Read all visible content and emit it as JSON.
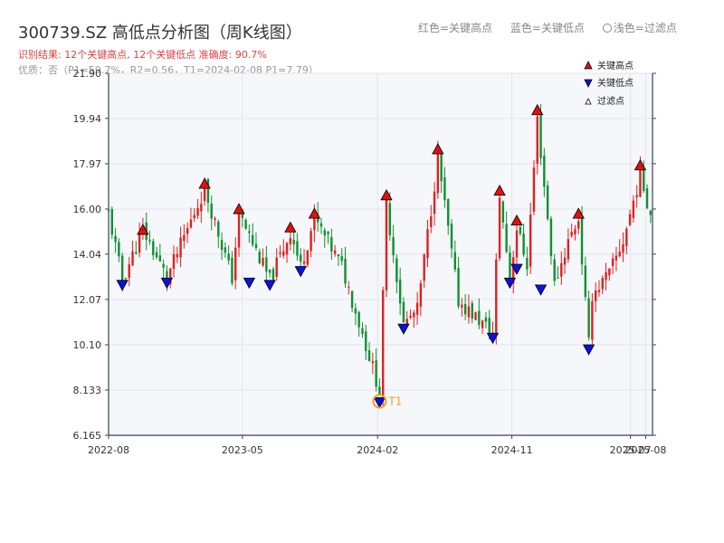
{
  "header": {
    "title": "300739.SZ 高低点分析图（周K线图）",
    "result": "识别结果: 12个关键高点, 12个关键低点   准确度: 90.7%",
    "quality": "优质：否（P1=59.7%，R2=0.56，T1=2024-02-08 P1=7.79）"
  },
  "legend_top": {
    "red": "红色=关键高点",
    "blue": "蓝色=关键低点",
    "light": "浅色=过滤点"
  },
  "legend": {
    "high": "关键高点",
    "low": "关键低点",
    "filtered": "过滤点"
  },
  "colors": {
    "up": "#e02020",
    "down": "#109030",
    "high_marker": "#e01010",
    "low_marker": "#1010e0",
    "t1": "#f0a020",
    "axis": "#33445a",
    "plot_bg": "#f5f7fa"
  },
  "chart_data": {
    "type": "candlestick",
    "y_ticks": [
      "6.165",
      "8.133",
      "10.10",
      "12.07",
      "14.04",
      "16.00",
      "17.97",
      "19.94",
      "21.90"
    ],
    "ylim": [
      6.165,
      21.9
    ],
    "x_ticks": [
      {
        "label": "2022-08",
        "date": "2022-08-01"
      },
      {
        "label": "2023-05",
        "date": "2023-05-01"
      },
      {
        "label": "2024-02",
        "date": "2024-02-01"
      },
      {
        "label": "2024-11",
        "date": "2024-11-01"
      },
      {
        "label": "2025-07",
        "date": "2025-07-01"
      },
      {
        "label": "2025-08",
        "date": "2025-08-01"
      }
    ],
    "x_range": [
      "2022-08-01",
      "2025-08-15"
    ],
    "anchors": [
      {
        "date": "2022-08-01",
        "price": 15.8
      },
      {
        "date": "2022-08-29",
        "price": 12.9
      },
      {
        "date": "2022-10-10",
        "price": 15.1
      },
      {
        "date": "2022-11-28",
        "price": 13.0
      },
      {
        "date": "2023-02-13",
        "price": 16.9
      },
      {
        "date": "2023-04-10",
        "price": 13.0
      },
      {
        "date": "2023-04-24",
        "price": 15.8
      },
      {
        "date": "2023-06-26",
        "price": 12.9
      },
      {
        "date": "2023-08-07",
        "price": 15.0
      },
      {
        "date": "2023-08-28",
        "price": 13.5
      },
      {
        "date": "2023-09-25",
        "price": 15.6
      },
      {
        "date": "2023-11-20",
        "price": 13.5
      },
      {
        "date": "2024-01-08",
        "price": 10.1
      },
      {
        "date": "2024-02-05",
        "price": 8.1
      },
      {
        "date": "2024-02-19",
        "price": 16.2
      },
      {
        "date": "2024-03-25",
        "price": 11.0
      },
      {
        "date": "2024-04-22",
        "price": 11.6
      },
      {
        "date": "2024-06-03",
        "price": 18.2
      },
      {
        "date": "2024-07-15",
        "price": 12.0
      },
      {
        "date": "2024-09-23",
        "price": 10.6
      },
      {
        "date": "2024-10-07",
        "price": 16.6
      },
      {
        "date": "2024-10-28",
        "price": 13.0
      },
      {
        "date": "2024-11-11",
        "price": 15.2
      },
      {
        "date": "2024-12-02",
        "price": 13.6
      },
      {
        "date": "2024-12-23",
        "price": 19.9
      },
      {
        "date": "2025-01-27",
        "price": 12.7
      },
      {
        "date": "2025-02-24",
        "price": 14.6
      },
      {
        "date": "2025-03-17",
        "price": 15.6
      },
      {
        "date": "2025-04-07",
        "price": 10.1
      },
      {
        "date": "2025-04-14",
        "price": 12.3
      },
      {
        "date": "2025-05-19",
        "price": 13.2
      },
      {
        "date": "2025-06-16",
        "price": 14.6
      },
      {
        "date": "2025-07-21",
        "price": 17.5
      },
      {
        "date": "2025-08-11",
        "price": 15.8
      }
    ],
    "key_highs": [
      {
        "date": "2022-10-10",
        "price": 14.9
      },
      {
        "date": "2023-02-13",
        "price": 16.9
      },
      {
        "date": "2023-04-24",
        "price": 15.8
      },
      {
        "date": "2023-08-07",
        "price": 15.0
      },
      {
        "date": "2023-09-25",
        "price": 15.6
      },
      {
        "date": "2024-02-19",
        "price": 16.4
      },
      {
        "date": "2024-06-03",
        "price": 18.4
      },
      {
        "date": "2024-10-07",
        "price": 16.6
      },
      {
        "date": "2024-11-11",
        "price": 15.3
      },
      {
        "date": "2024-12-23",
        "price": 20.1
      },
      {
        "date": "2025-03-17",
        "price": 15.6
      },
      {
        "date": "2025-07-21",
        "price": 17.7
      }
    ],
    "key_lows": [
      {
        "date": "2022-08-29",
        "price": 12.9
      },
      {
        "date": "2022-11-28",
        "price": 13.0
      },
      {
        "date": "2023-05-15",
        "price": 13.0
      },
      {
        "date": "2023-06-26",
        "price": 12.9
      },
      {
        "date": "2023-08-28",
        "price": 13.5
      },
      {
        "date": "2024-02-05",
        "price": 7.8
      },
      {
        "date": "2024-03-25",
        "price": 11.0
      },
      {
        "date": "2024-09-23",
        "price": 10.6
      },
      {
        "date": "2024-10-28",
        "price": 13.0
      },
      {
        "date": "2024-11-11",
        "price": 13.6
      },
      {
        "date": "2024-12-30",
        "price": 12.7
      },
      {
        "date": "2025-04-07",
        "price": 10.1
      }
    ],
    "t1": {
      "date": "2024-02-05",
      "price": 7.8,
      "label": "T1"
    }
  }
}
